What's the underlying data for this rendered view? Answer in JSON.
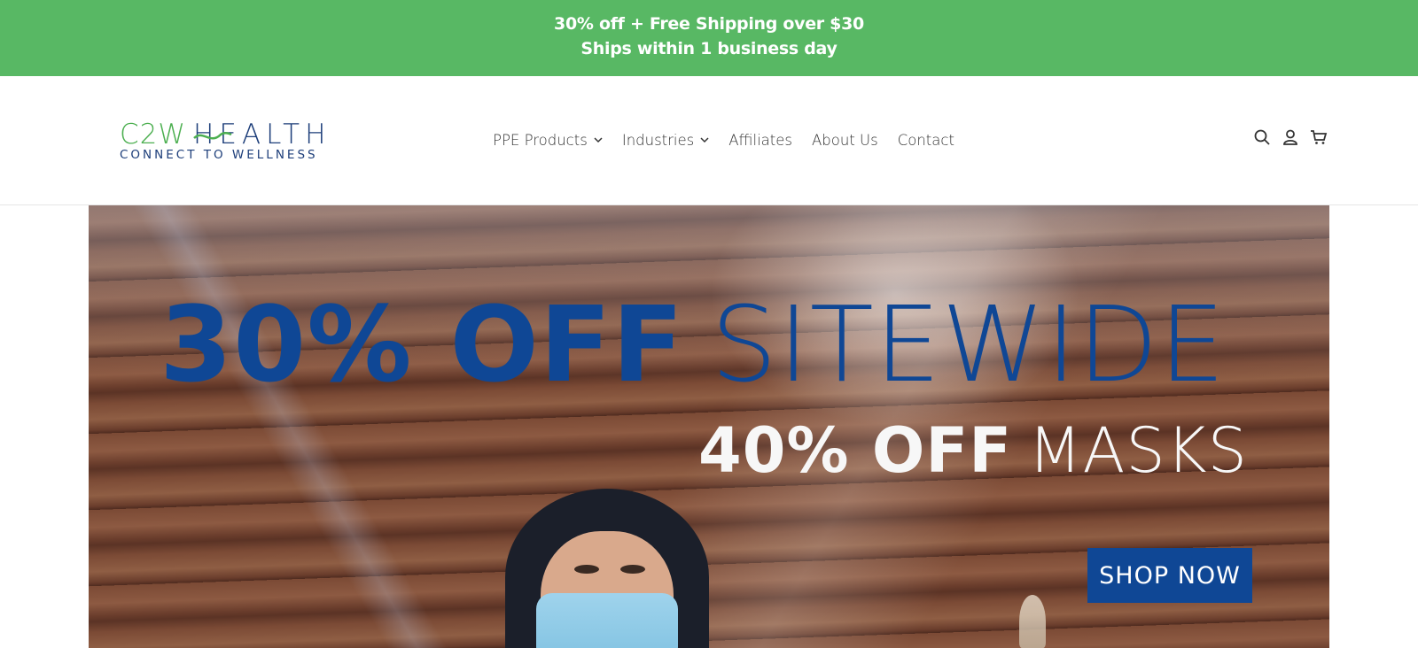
{
  "announcement": {
    "line1": "30% off + Free Shipping over $30",
    "line2": "Ships within 1 business day",
    "bg_color": "#58b864"
  },
  "header": {
    "logo": {
      "brand_c2w": "C2W",
      "brand_health": "HEALTH",
      "tagline": "CONNECT TO WELLNESS",
      "green": "#4caf50",
      "navy": "#1d3e7a"
    },
    "nav": [
      {
        "label": "PPE Products",
        "dropdown": true
      },
      {
        "label": "Industries",
        "dropdown": true
      },
      {
        "label": "Affiliates",
        "dropdown": false
      },
      {
        "label": "About Us",
        "dropdown": false
      },
      {
        "label": "Contact",
        "dropdown": false
      }
    ],
    "icons": [
      "search-icon",
      "account-icon",
      "cart-icon"
    ]
  },
  "hero": {
    "headline_bold": "30% OFF",
    "headline_thin": "SITEWIDE",
    "sub_bold": "40% OFF",
    "sub_thin": "MASKS",
    "cta": "SHOP NOW",
    "accent": "#0f4795"
  }
}
